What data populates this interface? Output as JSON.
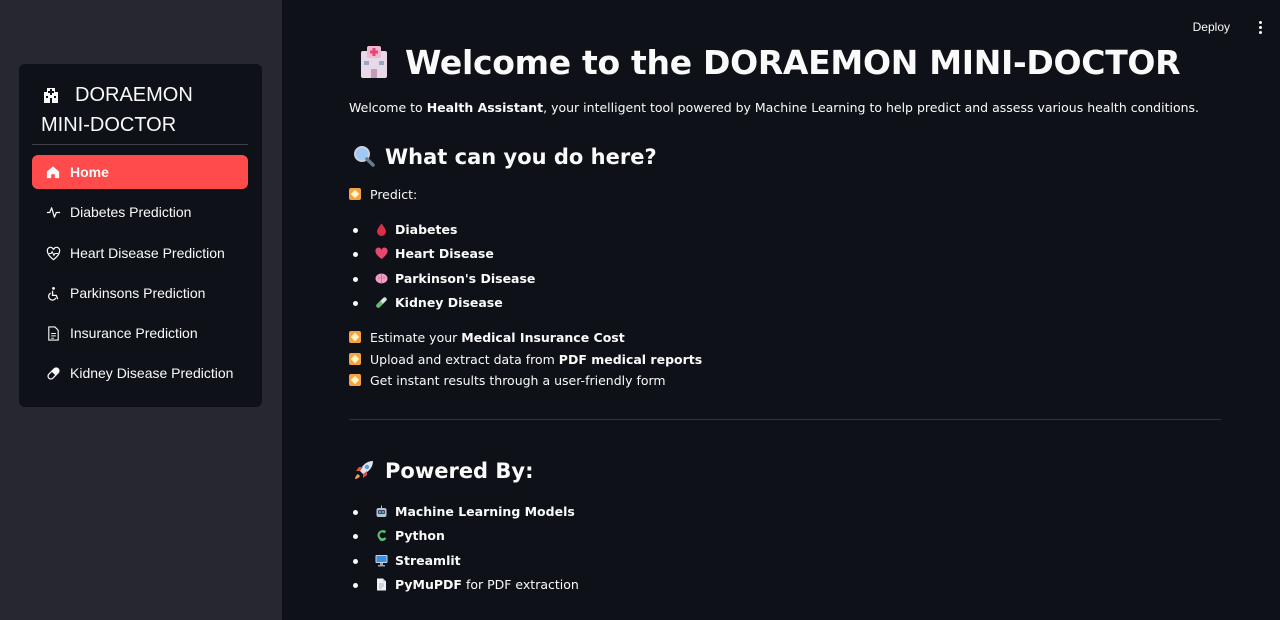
{
  "header": {
    "deploy_label": "Deploy",
    "menu_icon": "kebab-menu-icon"
  },
  "sidebar": {
    "menu_title": "DORAEMON MINI-DOCTOR",
    "menu_title_icon": "hospital-icon",
    "accent_color": "#ff4b4b",
    "items": [
      {
        "label": "Home",
        "icon": "house-icon",
        "active": true
      },
      {
        "label": "Diabetes Prediction",
        "icon": "activity-icon",
        "active": false
      },
      {
        "label": "Heart Disease Prediction",
        "icon": "heart-pulse-icon",
        "active": false
      },
      {
        "label": "Parkinsons Prediction",
        "icon": "wheelchair-icon",
        "active": false
      },
      {
        "label": "Insurance Prediction",
        "icon": "document-icon",
        "active": false
      },
      {
        "label": "Kidney Disease Prediction",
        "icon": "capsule-icon",
        "active": false
      }
    ]
  },
  "main": {
    "title": "Welcome to the DORAEMON MINI-DOCTOR",
    "title_icon": "hospital-emoji-icon",
    "intro": {
      "prefix": "Welcome to ",
      "bold": "Health Assistant",
      "suffix": ", your intelligent tool powered by Machine Learning to help predict and assess various health conditions."
    },
    "what_section": {
      "heading": "What can you do here?",
      "icon": "magnifying-glass-icon",
      "predict_label": "Predict:",
      "predict_items": [
        {
          "label": "Diabetes",
          "icon": "drop-of-blood-icon"
        },
        {
          "label": "Heart Disease",
          "icon": "heart-icon"
        },
        {
          "label": "Parkinson's Disease",
          "icon": "brain-icon"
        },
        {
          "label": "Kidney Disease",
          "icon": "test-tube-icon"
        }
      ],
      "features": [
        {
          "prefix": "Estimate your ",
          "bold": "Medical Insurance Cost",
          "suffix": ""
        },
        {
          "prefix": "Upload and extract data from ",
          "bold": "PDF medical reports",
          "suffix": ""
        },
        {
          "prefix": "Get instant results through a user-friendly form",
          "bold": "",
          "suffix": ""
        }
      ]
    },
    "powered_section": {
      "heading": "Powered By:",
      "icon": "rocket-icon",
      "items": [
        {
          "label": "Machine Learning Models",
          "suffix": "",
          "icon": "robot-icon"
        },
        {
          "label": "Python",
          "suffix": "",
          "icon": "snake-icon"
        },
        {
          "label": "Streamlit",
          "suffix": "",
          "icon": "desktop-computer-icon"
        },
        {
          "label": "PyMuPDF",
          "suffix": " for PDF extraction",
          "icon": "page-icon"
        }
      ]
    }
  }
}
